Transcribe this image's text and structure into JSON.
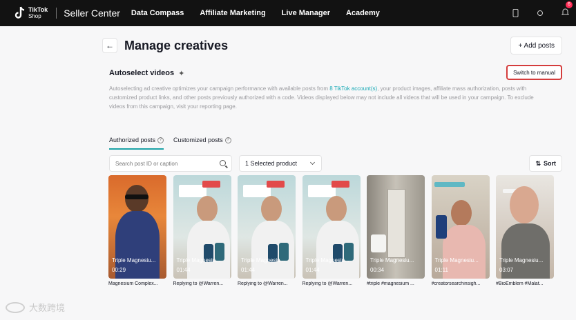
{
  "topbar": {
    "logo_line1": "TikTok",
    "logo_line2": "Shop",
    "app_title": "Seller Center",
    "nav": [
      "Data Compass",
      "Affiliate Marketing",
      "Live Manager",
      "Academy"
    ],
    "notification_count": "6"
  },
  "page": {
    "title": "Manage creatives",
    "add_posts_label": "+ Add posts"
  },
  "autoselect": {
    "title": "Autoselect videos",
    "switch_label": "Switch to manual",
    "desc_part1": "Autoselecting ad creative optimizes your campaign performance with available posts from ",
    "desc_link": "8 TikTok account(s)",
    "desc_part2": ", your product images, affiliate mass authorization, posts with customized product links, and other posts previously authorized with a code. Videos displayed below may not include all videos that will be used in your campaign. To exclude videos from this campaign, visit your reporting page."
  },
  "tabs": [
    "Authorized posts",
    "Customized posts"
  ],
  "filters": {
    "search_placeholder": "Search post ID or caption",
    "product_select": "1 Selected product",
    "sort_label": "Sort"
  },
  "videos": [
    {
      "label": "Triple Magnesiu...",
      "time": "00:29",
      "caption": "Magnesium Complex..."
    },
    {
      "label": "Triple Magnesiu...",
      "time": "01:44",
      "caption": "Replying to @Warren..."
    },
    {
      "label": "Triple Magnesiu...",
      "time": "01:44",
      "caption": "Replying to @Warren..."
    },
    {
      "label": "Triple Magnesiu...",
      "time": "01:44",
      "caption": "Replying to @Warren..."
    },
    {
      "label": "Triple Magnesiu...",
      "time": "00:34",
      "caption": "#triple #magnesium ..."
    },
    {
      "label": "Triple Magnesiu...",
      "time": "01:11",
      "caption": "#creatorsearchinsigh..."
    },
    {
      "label": "Triple Magnesiu...",
      "time": "03:07",
      "caption": "#BioEmblem #Malat..."
    }
  ],
  "watermark": "大数跨境",
  "colors": {
    "topbar": "#121212",
    "accent_teal": "#1aa2a6",
    "highlight_red": "#d43c3c",
    "badge": "#fe2c55"
  }
}
